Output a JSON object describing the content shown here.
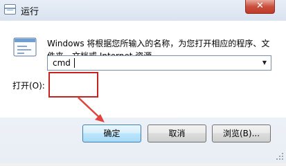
{
  "window": {
    "title": "运行",
    "close_label": "✕",
    "icon": "run-dialog-icon"
  },
  "content": {
    "description": "Windows 将根据您所输入的名称，为您打开相应的程序、文件夹、文档或 Internet 资源。",
    "open_label": "打开(O):",
    "open_value": "cmd",
    "run_icon": "run-program-icon"
  },
  "buttons": {
    "ok": "确定",
    "cancel": "取消",
    "browse": "浏览(B)..."
  },
  "annotation": {
    "highlight_color": "#c8211e"
  }
}
